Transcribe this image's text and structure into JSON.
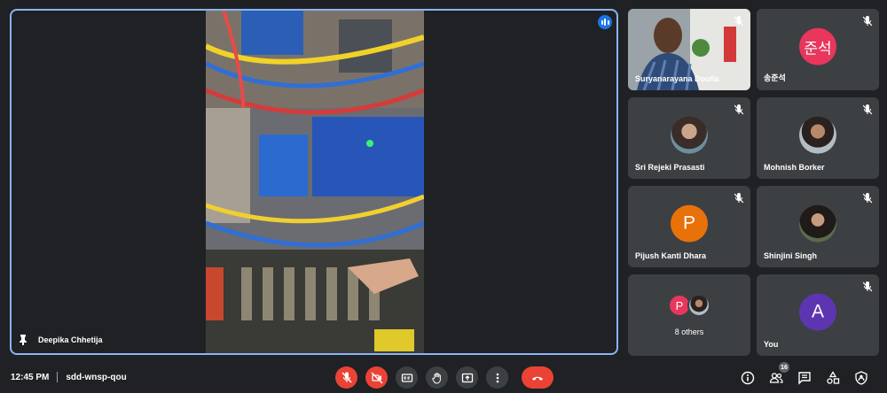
{
  "main_video": {
    "participant": "Deepika Chhetija"
  },
  "participants": [
    {
      "name": "Suryanarayana Doolla",
      "kind": "video"
    },
    {
      "name": "송준석",
      "initials": "준석",
      "color": "#e8365d"
    },
    {
      "name": "Sri Rejeki Prasasti",
      "kind": "photo"
    },
    {
      "name": "Mohnish Borker",
      "kind": "photo"
    },
    {
      "name": "Pijush Kanti Dhara",
      "initials": "P",
      "color": "#e8710a"
    },
    {
      "name": "Shinjini Singh",
      "kind": "photo"
    },
    {
      "label": "8 others",
      "initials": "P",
      "color": "#e8365d"
    },
    {
      "name": "You",
      "initials": "A",
      "color": "#5e35b1"
    }
  ],
  "meeting": {
    "time": "12:45 PM",
    "code": "sdd-wnsp-qou"
  },
  "people_count": "16",
  "icons": [
    "speaking-indicator-icon",
    "pin-icon",
    "mic-off-icon",
    "camera-off-icon",
    "captions-icon",
    "raise-hand-icon",
    "present-icon",
    "more-options-icon",
    "end-call-icon",
    "info-icon",
    "people-icon",
    "chat-icon",
    "activities-icon",
    "host-controls-icon"
  ]
}
